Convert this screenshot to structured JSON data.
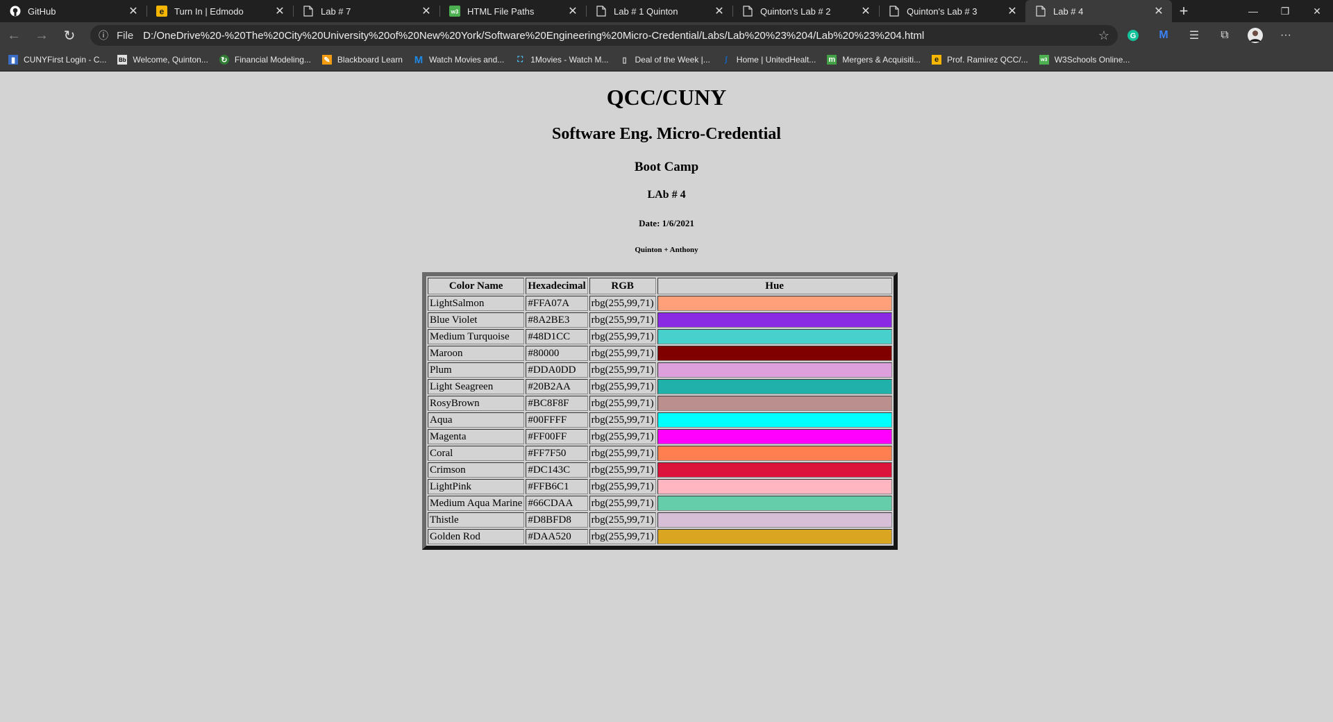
{
  "browser": {
    "tabs": [
      {
        "title": "GitHub",
        "icon": "github-icon",
        "active": false
      },
      {
        "title": "Turn In | Edmodo",
        "icon": "edmodo-icon",
        "active": false
      },
      {
        "title": "Lab # 7",
        "icon": "file-icon",
        "active": false
      },
      {
        "title": "HTML File Paths",
        "icon": "w3schools-icon",
        "active": false
      },
      {
        "title": "Lab # 1 Quinton",
        "icon": "file-icon",
        "active": false
      },
      {
        "title": "Quinton's Lab # 2",
        "icon": "file-icon",
        "active": false
      },
      {
        "title": "Quinton's Lab # 3",
        "icon": "file-icon",
        "active": false
      },
      {
        "title": "Lab # 4",
        "icon": "file-icon",
        "active": true
      }
    ],
    "address": {
      "scheme": "File",
      "url": "D:/OneDrive%20-%20The%20City%20University%20of%20New%20York/Software%20Engineering%20Micro-Credential/Labs/Lab%20%23%204/Lab%20%23%204.html"
    },
    "bookmarks": [
      {
        "label": "CUNYFirst Login - C...",
        "color": "#3b6cc4"
      },
      {
        "label": "Welcome, Quinton...",
        "color": "#e0e0e0"
      },
      {
        "label": "Financial Modeling...",
        "color": "#2e7d32"
      },
      {
        "label": "Blackboard Learn",
        "color": "#f39c12"
      },
      {
        "label": "Watch Movies and...",
        "color": "#1e88e5"
      },
      {
        "label": "1Movies - Watch M...",
        "color": "#4fc3f7"
      },
      {
        "label": "Deal of the Week |...",
        "color": "#e0e0e0"
      },
      {
        "label": "Home | UnitedHealt...",
        "color": "#1565c0"
      },
      {
        "label": "Mergers & Acquisiti...",
        "color": "#43a047"
      },
      {
        "label": "Prof. Ramirez QCC/...",
        "color": "#f6b600"
      },
      {
        "label": "W3Schools Online...",
        "color": "#4caf50"
      }
    ]
  },
  "page": {
    "h1": "QCC/CUNY",
    "h2": "Software Eng. Micro-Credential",
    "h3": "Boot Camp",
    "h4": "LAb # 4",
    "h5": "Date: 1/6/2021",
    "h6": "Quinton + Anthony",
    "table": {
      "headers": [
        "Color Name",
        "Hexadecimal",
        "RGB",
        "Hue"
      ],
      "rows": [
        {
          "name": "LightSalmon",
          "hex": "#FFA07A",
          "rgb": "rbg(255,99,71)",
          "color": "#FFA07A"
        },
        {
          "name": "Blue Violet",
          "hex": "#8A2BE3",
          "rgb": "rbg(255,99,71)",
          "color": "#8A2BE3"
        },
        {
          "name": "Medium Turquoise",
          "hex": "#48D1CC",
          "rgb": "rbg(255,99,71)",
          "color": "#48D1CC"
        },
        {
          "name": "Maroon",
          "hex": "#80000",
          "rgb": "rbg(255,99,71)",
          "color": "#800000"
        },
        {
          "name": "Plum",
          "hex": "#DDA0DD",
          "rgb": "rbg(255,99,71)",
          "color": "#DDA0DD"
        },
        {
          "name": "Light Seagreen",
          "hex": "#20B2AA",
          "rgb": "rbg(255,99,71)",
          "color": "#20B2AA"
        },
        {
          "name": "RosyBrown",
          "hex": "#BC8F8F",
          "rgb": "rbg(255,99,71)",
          "color": "#BC8F8F"
        },
        {
          "name": "Aqua",
          "hex": "#00FFFF",
          "rgb": "rbg(255,99,71)",
          "color": "#00FFFF"
        },
        {
          "name": "Magenta",
          "hex": "#FF00FF",
          "rgb": "rbg(255,99,71)",
          "color": "#FF00FF"
        },
        {
          "name": "Coral",
          "hex": "#FF7F50",
          "rgb": "rbg(255,99,71)",
          "color": "#FF7F50"
        },
        {
          "name": "Crimson",
          "hex": "#DC143C",
          "rgb": "rbg(255,99,71)",
          "color": "#DC143C"
        },
        {
          "name": "LightPink",
          "hex": "#FFB6C1",
          "rgb": "rbg(255,99,71)",
          "color": "#FFB6C1"
        },
        {
          "name": "Medium Aqua Marine",
          "hex": "#66CDAA",
          "rgb": "rbg(255,99,71)",
          "color": "#66CDAA"
        },
        {
          "name": "Thistle",
          "hex": "#D8BFD8",
          "rgb": "rbg(255,99,71)",
          "color": "#D8BFD8"
        },
        {
          "name": "Golden Rod",
          "hex": "#DAA520",
          "rgb": "rbg(255,99,71)",
          "color": "#DAA520"
        }
      ]
    }
  }
}
